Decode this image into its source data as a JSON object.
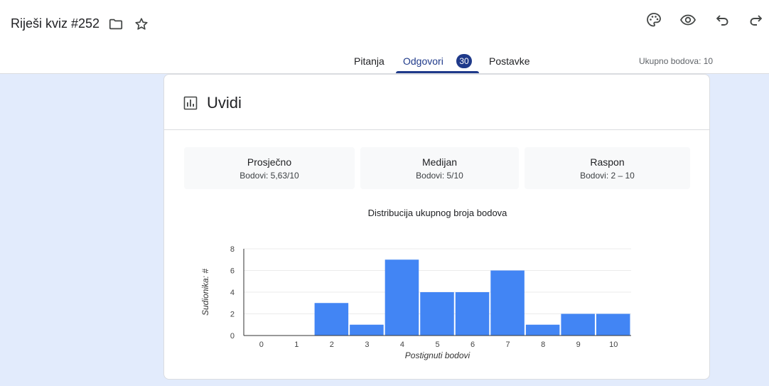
{
  "header": {
    "doc_title": "Riješi kviz #252",
    "icons": [
      "folder-icon",
      "star-icon",
      "palette-icon",
      "eye-icon",
      "undo-icon",
      "redo-icon"
    ]
  },
  "tabs": {
    "questions": "Pitanja",
    "responses": "Odgovori",
    "responses_count": "30",
    "settings": "Postavke",
    "active": "responses"
  },
  "total_points": "Ukupno bodova: 10",
  "insights": {
    "title": "Uvidi",
    "stats": [
      {
        "label": "Prosječno",
        "value": "Bodovi: 5,63/10"
      },
      {
        "label": "Medijan",
        "value": "Bodovi: 5/10"
      },
      {
        "label": "Raspon",
        "value": "Bodovi: 2 – 10"
      }
    ]
  },
  "colors": {
    "accent": "#1f3a8a",
    "bar": "#4285f4",
    "page_bg": "#e2ebfc"
  },
  "chart_data": {
    "type": "bar",
    "title": "Distribucija ukupnog broja bodova",
    "xlabel": "Postignuti bodovi",
    "ylabel": "Sudionika: #",
    "categories": [
      "0",
      "1",
      "2",
      "3",
      "4",
      "5",
      "6",
      "7",
      "8",
      "9",
      "10"
    ],
    "values": [
      0,
      0,
      3,
      1,
      7,
      4,
      4,
      6,
      1,
      2,
      2
    ],
    "ylim": [
      0,
      8
    ],
    "yticks": [
      "0",
      "2",
      "4",
      "6",
      "8"
    ],
    "grid": true,
    "legend": "none"
  }
}
